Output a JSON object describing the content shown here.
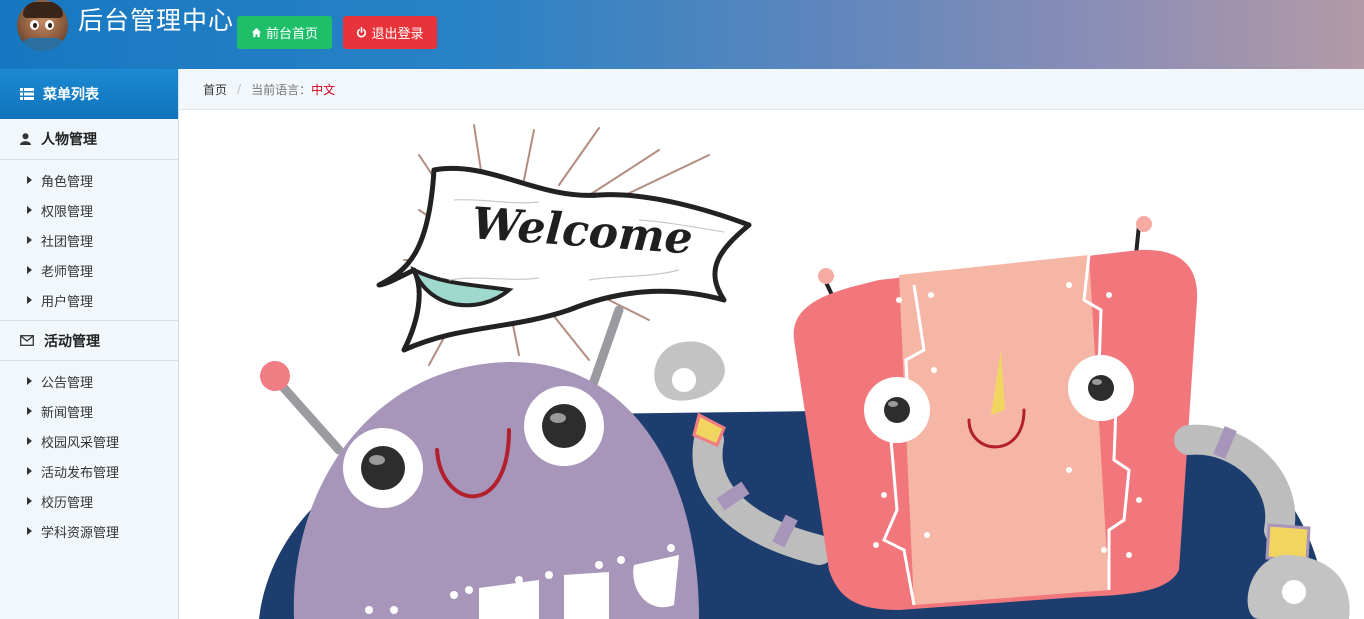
{
  "header": {
    "title": "后台管理中心",
    "home_button": "前台首页",
    "logout_button": "退出登录"
  },
  "sidebar": {
    "menu_title": "菜单列表",
    "groups": [
      {
        "title": "人物管理",
        "items": [
          "角色管理",
          "权限管理",
          "社团管理",
          "老师管理",
          "用户管理"
        ]
      },
      {
        "title": "活动管理",
        "items": [
          "公告管理",
          "新闻管理",
          "校园风采管理",
          "活动发布管理",
          "校历管理",
          "学科资源管理"
        ]
      }
    ]
  },
  "breadcrumb": {
    "home": "首页",
    "separator": "/",
    "language_label": "当前语言：",
    "language_value": "中文"
  },
  "banner": {
    "text": "Welcome"
  },
  "colors": {
    "header_gradient_start": "#1678c2",
    "header_gradient_end": "#b39aa6",
    "home_button": "#1fbf6a",
    "logout_button": "#e8333a",
    "menu_header": "#0f73bb",
    "sidebar_bg": "#f1f7fb",
    "language_value": "#d0021b"
  }
}
